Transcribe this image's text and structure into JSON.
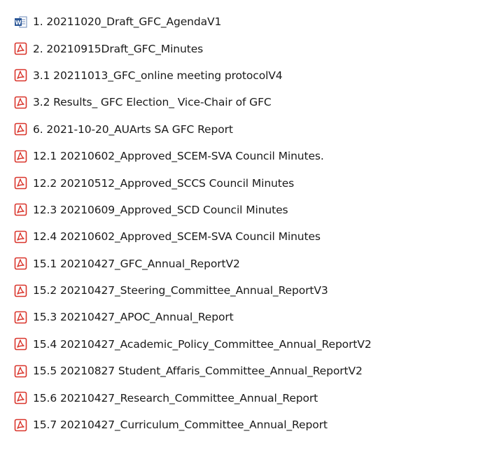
{
  "file_list": {
    "items": [
      {
        "name": "1. 20211020_Draft_GFC_AgendaV1",
        "type": "word",
        "icon": "word-document-icon"
      },
      {
        "name": "2. 20210915Draft_GFC_Minutes",
        "type": "pdf",
        "icon": "pdf-document-icon"
      },
      {
        "name": "3.1 20211013_GFC_online meeting protocolV4",
        "type": "pdf",
        "icon": "pdf-document-icon"
      },
      {
        "name": "3.2 Results_ GFC Election_ Vice-Chair of GFC",
        "type": "pdf",
        "icon": "pdf-document-icon"
      },
      {
        "name": "6. 2021-10-20_AUArts SA GFC Report",
        "type": "pdf",
        "icon": "pdf-document-icon"
      },
      {
        "name": "12.1 20210602_Approved_SCEM-SVA Council Minutes.",
        "type": "pdf",
        "icon": "pdf-document-icon"
      },
      {
        "name": "12.2 20210512_Approved_SCCS Council Minutes",
        "type": "pdf",
        "icon": "pdf-document-icon"
      },
      {
        "name": "12.3 20210609_Approved_SCD Council Minutes",
        "type": "pdf",
        "icon": "pdf-document-icon"
      },
      {
        "name": "12.4 20210602_Approved_SCEM-SVA Council Minutes",
        "type": "pdf",
        "icon": "pdf-document-icon"
      },
      {
        "name": "15.1 20210427_GFC_Annual_ReportV2",
        "type": "pdf",
        "icon": "pdf-document-icon"
      },
      {
        "name": "15.2 20210427_Steering_Committee_Annual_ReportV3",
        "type": "pdf",
        "icon": "pdf-document-icon"
      },
      {
        "name": "15.3 20210427_APOC_Annual_Report",
        "type": "pdf",
        "icon": "pdf-document-icon"
      },
      {
        "name": "15.4 20210427_Academic_Policy_Committee_Annual_ReportV2",
        "type": "pdf",
        "icon": "pdf-document-icon"
      },
      {
        "name": "15.5 20210827 Student_Affaris_Committee_Annual_ReportV2",
        "type": "pdf",
        "icon": "pdf-document-icon"
      },
      {
        "name": "15.6 20210427_Research_Committee_Annual_Report",
        "type": "pdf",
        "icon": "pdf-document-icon"
      },
      {
        "name": "15.7 20210427_Curriculum_Committee_Annual_Report",
        "type": "pdf",
        "icon": "pdf-document-icon"
      }
    ]
  },
  "colors": {
    "pdf_red": "#d9342b",
    "word_blue": "#2b5797",
    "text": "#1a1a1a"
  }
}
